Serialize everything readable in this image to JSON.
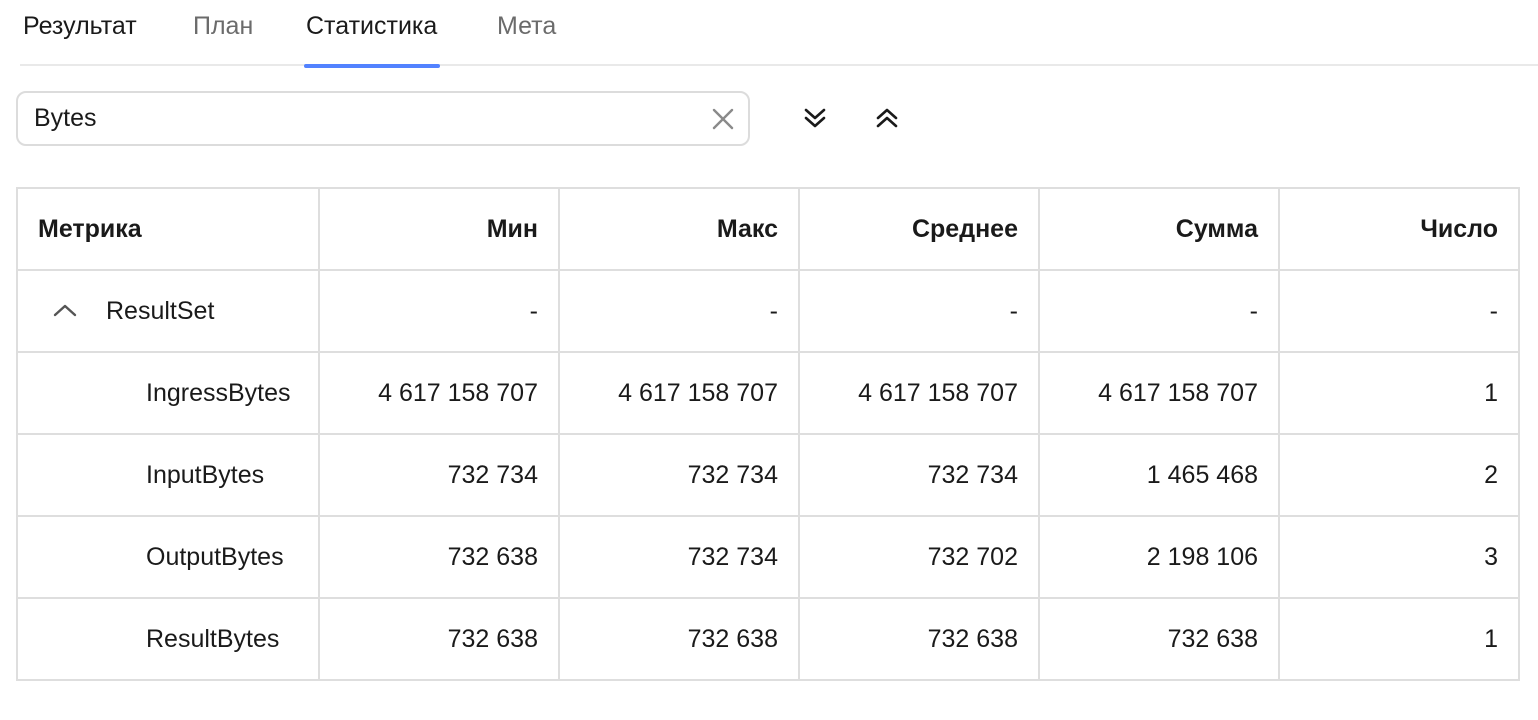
{
  "tabs": [
    {
      "label": "Результат"
    },
    {
      "label": "План"
    },
    {
      "label": "Статистика"
    },
    {
      "label": "Мета"
    }
  ],
  "active_tab": "Статистика",
  "search": {
    "value": "Bytes"
  },
  "toolbar": {
    "expand_all_icon": "chevrons-down-icon",
    "collapse_all_icon": "chevrons-up-icon"
  },
  "colors": {
    "accent": "#5282ff",
    "border": "#dedede"
  },
  "table": {
    "headers": {
      "metric": "Метрика",
      "min": "Мин",
      "max": "Макс",
      "avg": "Среднее",
      "sum": "Сумма",
      "count": "Число"
    },
    "group": {
      "name": "ResultSet",
      "expanded": true,
      "min": "-",
      "max": "-",
      "avg": "-",
      "sum": "-",
      "count": "-"
    },
    "rows": [
      {
        "name": "IngressBytes",
        "min": "4 617 158 707",
        "max": "4 617 158 707",
        "avg": "4 617 158 707",
        "sum": "4 617 158 707",
        "count": "1"
      },
      {
        "name": "InputBytes",
        "min": "732 734",
        "max": "732 734",
        "avg": "732 734",
        "sum": "1 465 468",
        "count": "2"
      },
      {
        "name": "OutputBytes",
        "min": "732 638",
        "max": "732 734",
        "avg": "732 702",
        "sum": "2 198 106",
        "count": "3"
      },
      {
        "name": "ResultBytes",
        "min": "732 638",
        "max": "732 638",
        "avg": "732 638",
        "sum": "732 638",
        "count": "1"
      }
    ]
  }
}
